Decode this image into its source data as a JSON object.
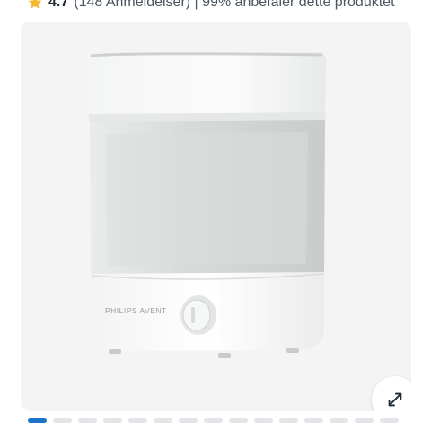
{
  "rating": {
    "value": "4.7",
    "text": "(148 Anmeldelser) | 99% anbefaler dette produktet",
    "star_icon": "star-icon",
    "star_color": "#f5b82e"
  },
  "gallery": {
    "brand_label": "PHILIPS AVENT",
    "background": "#f4f4f5",
    "expand_icon": "expand-icon",
    "slide_count": 15,
    "active_index": 0,
    "active_color": "#1a73c8"
  }
}
